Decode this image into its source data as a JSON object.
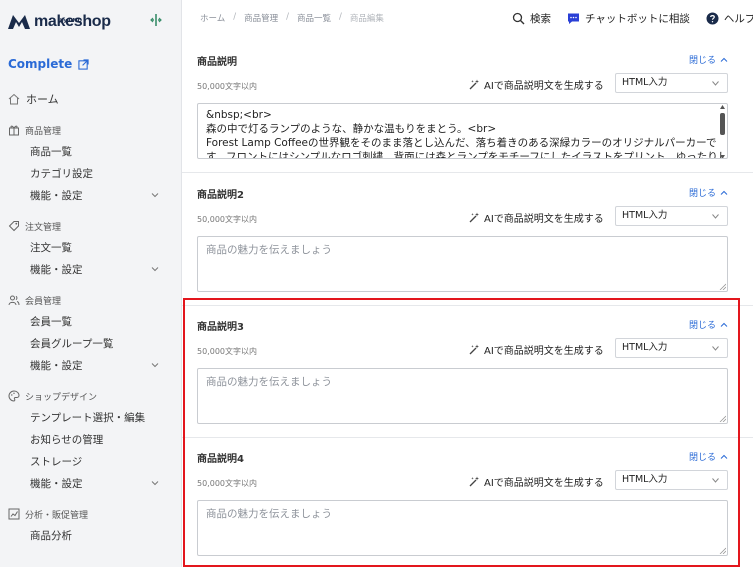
{
  "sidebar": {
    "logo_text": "makeshop",
    "logo_sub": "by GMO",
    "status_label": "Complete",
    "home_label": "ホーム",
    "sections": [
      {
        "title": "商品管理",
        "icon": "gift-icon",
        "items": [
          "商品一覧",
          "カテゴリ設定",
          "機能・設定"
        ]
      },
      {
        "title": "注文管理",
        "icon": "tag-icon",
        "items": [
          "注文一覧",
          "機能・設定"
        ]
      },
      {
        "title": "会員管理",
        "icon": "users-icon",
        "items": [
          "会員一覧",
          "会員グループ一覧",
          "機能・設定"
        ]
      },
      {
        "title": "ショップデザイン",
        "icon": "palette-icon",
        "items": [
          "テンプレート選択・編集",
          "お知らせの管理",
          "ストレージ",
          "機能・設定"
        ]
      },
      {
        "title": "分析・販促管理",
        "icon": "chart-icon",
        "items": [
          "商品分析"
        ]
      }
    ]
  },
  "breadcrumb": [
    "ホーム",
    "商品管理",
    "商品一覧",
    "商品編集"
  ],
  "header": {
    "search_label": "検索",
    "chatbot_label": "チャットボットに相談",
    "help_label": "ヘルプ"
  },
  "fields": [
    {
      "title": "商品説明",
      "close_label": "閉じる",
      "limit": "50,000文字以内",
      "ai_label": "AIで商品説明文を生成する",
      "mode": "HTML入力",
      "lines": [
        "&nbsp;<br>",
        "森の中で灯るランプのような、静かな温もりをまとう。<br>",
        "Forest Lamp Coffeeの世界観をそのまま落とし込んだ、落ち着きのある深緑カラーのオリジナルパーカーで",
        "す。フロントにはシンプルなロゴ刺繍、背面には森とランプをモチーフにしたイラストをプリント。ゆったりし"
      ],
      "placeholder": ""
    },
    {
      "title": "商品説明2",
      "close_label": "閉じる",
      "limit": "50,000文字以内",
      "ai_label": "AIで商品説明文を生成する",
      "mode": "HTML入力",
      "placeholder": "商品の魅力を伝えましょう"
    },
    {
      "title": "商品説明3",
      "close_label": "閉じる",
      "limit": "50,000文字以内",
      "ai_label": "AIで商品説明文を生成する",
      "mode": "HTML入力",
      "placeholder": "商品の魅力を伝えましょう"
    },
    {
      "title": "商品説明4",
      "close_label": "閉じる",
      "limit": "50,000文字以内",
      "ai_label": "AIで商品説明文を生成する",
      "mode": "HTML入力",
      "placeholder": "商品の魅力を伝えましょう"
    }
  ],
  "colors": {
    "accent": "#2a6ad6",
    "highlight": "#e3161d",
    "chatbot": "#2a3fd6"
  }
}
